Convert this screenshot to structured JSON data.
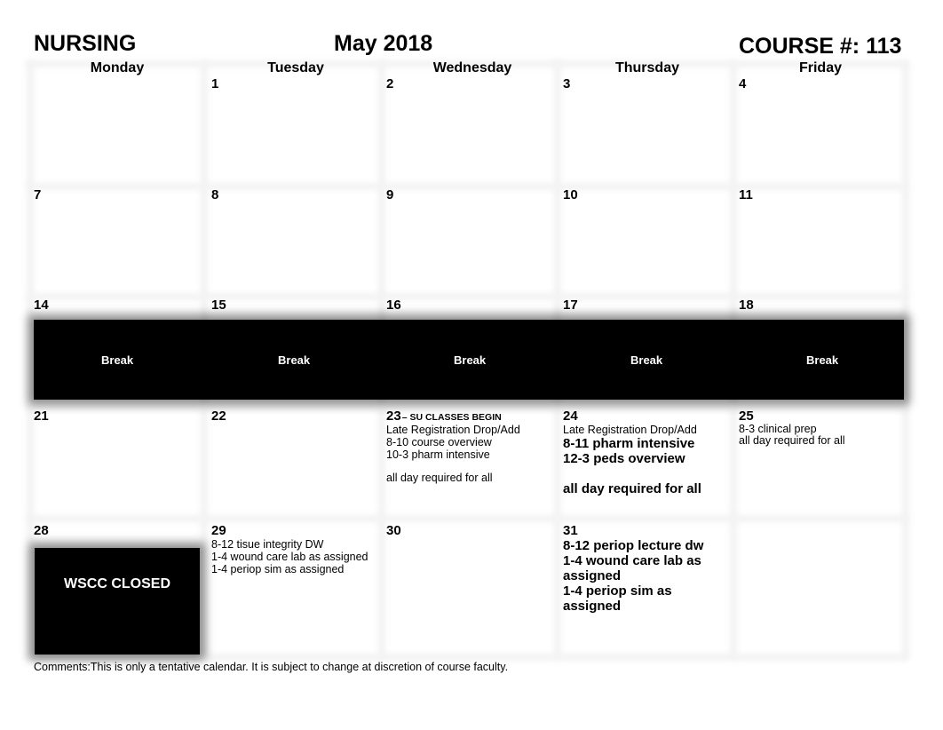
{
  "header": {
    "left": "NURSING",
    "center": "May 2018",
    "right": "COURSE #: 113"
  },
  "weekdays": [
    "Monday",
    "Tuesday",
    "Wednesday",
    "Thursday",
    "Friday"
  ],
  "weeks": [
    {
      "days": [
        {
          "num": "",
          "lines": []
        },
        {
          "num": "1",
          "lines": []
        },
        {
          "num": "2",
          "lines": []
        },
        {
          "num": "3",
          "lines": []
        },
        {
          "num": "4",
          "lines": []
        }
      ]
    },
    {
      "days": [
        {
          "num": "7",
          "lines": []
        },
        {
          "num": "8",
          "lines": []
        },
        {
          "num": "9",
          "lines": []
        },
        {
          "num": "10",
          "lines": []
        },
        {
          "num": "11",
          "lines": []
        }
      ]
    },
    {
      "days": [
        {
          "num": "14",
          "label": "Break"
        },
        {
          "num": "15",
          "label": "Break"
        },
        {
          "num": "16",
          "label": "Break"
        },
        {
          "num": "17",
          "label": "Break"
        },
        {
          "num": "18",
          "label": "Break"
        }
      ]
    },
    {
      "days": [
        {
          "num": "21",
          "lines": []
        },
        {
          "num": "22",
          "lines": []
        },
        {
          "num": "23",
          "suffix": "– SU CLASSES BEGIN",
          "lines": [
            "Late Registration Drop/Add",
            "8-10 course overview",
            "10-3 pharm intensive",
            "",
            "all day required for all"
          ]
        },
        {
          "num": "24",
          "lines": [
            "Late Registration Drop/Add",
            "8-11 pharm intensive",
            "12-3 peds overview",
            "",
            "all day required for all"
          ]
        },
        {
          "num": "25",
          "lines": [
            "8-3 clinical prep",
            "all day required for all"
          ]
        }
      ]
    },
    {
      "days": [
        {
          "num": "28",
          "label": "WSCC CLOSED"
        },
        {
          "num": "29",
          "lines": [
            "8-12 tisue integrity DW",
            "1-4 wound care lab as assigned",
            "1-4 periop sim as assigned"
          ]
        },
        {
          "num": "30",
          "lines": []
        },
        {
          "num": "31",
          "lines": [
            "8-12 periop lecture dw",
            "1-4 wound care lab as",
            "assigned",
            "1-4 periop sim as assigned"
          ]
        },
        {
          "num": "",
          "lines": []
        }
      ]
    }
  ],
  "comments": "Comments:This is only a tentative calendar. It is subject to change at discretion of course faculty."
}
